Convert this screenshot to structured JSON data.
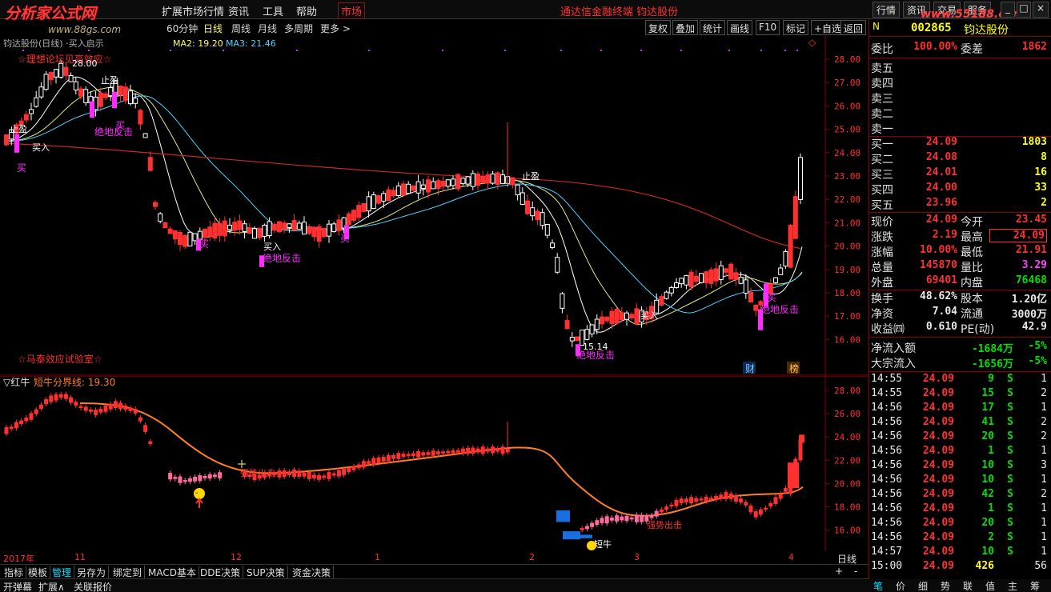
{
  "menubar": {
    "watermark": "分析家公式网",
    "watermark2": "www.88gs.com",
    "items": [
      "扩展市场行情",
      "资讯",
      "工具",
      "帮助"
    ],
    "market_tab": "市场",
    "center_title": "通达信金融终端  钧达股份",
    "right_buttons": [
      "行情",
      "资讯",
      "交易",
      "服务"
    ],
    "wm_site": "www.55188.com"
  },
  "periodbar": {
    "periods": [
      "60分钟",
      "日线",
      "周线",
      "月线",
      "多周期",
      "更多 >"
    ],
    "selected": "日线",
    "ma_text": {
      "ma2": "MA2: 19.20",
      "ma3": "MA3: 21.46"
    },
    "tools": [
      "复权",
      "叠加",
      "统计",
      "画线",
      "F10",
      "标记",
      "+自选",
      "返回"
    ]
  },
  "mainchart": {
    "header_text": "钧达股份(日线) ·买入启示",
    "ytick_labels": [
      "28.00",
      "27.00",
      "26.00",
      "25.00",
      "24.00",
      "23.00",
      "22.00",
      "21.00",
      "20.00",
      "19.00",
      "18.00",
      "17.00",
      "16.00"
    ],
    "annotations": {
      "top_left": "☆理想论坛见高效应☆",
      "bottom_left": "☆马泰效应试验室☆",
      "high_label": "28.00",
      "low_label": "15.14",
      "zhiying1": "止盈",
      "zhiying2": "止盈",
      "zhiying3": "止盈",
      "mairu1": "买入",
      "mairu2": "买入",
      "mairu3": "买入",
      "mai_a": "买",
      "mai_b": "买",
      "mai_c": "买",
      "mai_d": "买",
      "mai_e": "买",
      "fanji1": "绝地反击",
      "fanji2": "绝地反击",
      "fanji3": "绝地反击",
      "fanji4": "绝地反击",
      "cai": "财",
      "bang": "榜"
    }
  },
  "subchart": {
    "title": "▽红牛",
    "line_label": "短牛分界线: 19.30",
    "ytick_labels": [
      "28.00",
      "26.00",
      "24.00",
      "22.00",
      "20.00",
      "18.00",
      "16.00"
    ],
    "annotations": {
      "chuji1": "强势出击",
      "chuji2": "强势出击",
      "duanniu": "短牛"
    }
  },
  "timeaxis": {
    "labels": [
      "2017年",
      "11",
      "12",
      "1",
      "2",
      "3",
      "4"
    ],
    "period": "日线"
  },
  "tabs": [
    "指标",
    "模板",
    "管理",
    "另存为",
    "绑定到",
    "MACD基本",
    "DDE决策",
    "SUP决策",
    "资金决策"
  ],
  "tabs_selected": "管理",
  "status": [
    "开弹幕",
    "扩展∧",
    "关联报价"
  ],
  "rpanel": {
    "code": "002865",
    "name": "钧达股份",
    "weibi": {
      "label": "委比",
      "value": "100.00%",
      "label2": "委差",
      "value2": "1862"
    },
    "sell": [
      {
        "label": "卖五",
        "price": "",
        "vol": ""
      },
      {
        "label": "卖四",
        "price": "",
        "vol": ""
      },
      {
        "label": "卖三",
        "price": "",
        "vol": ""
      },
      {
        "label": "卖二",
        "price": "",
        "vol": ""
      },
      {
        "label": "卖一",
        "price": "",
        "vol": ""
      }
    ],
    "buy": [
      {
        "label": "买一",
        "price": "24.09",
        "vol": "1803"
      },
      {
        "label": "买二",
        "price": "24.08",
        "vol": "8"
      },
      {
        "label": "买三",
        "price": "24.01",
        "vol": "16"
      },
      {
        "label": "买四",
        "price": "24.00",
        "vol": "33"
      },
      {
        "label": "买五",
        "price": "23.96",
        "vol": "2"
      }
    ],
    "stats": [
      {
        "l1": "现价",
        "v1": "24.09",
        "c1": "red",
        "l2": "今开",
        "v2": "23.45",
        "c2": "red"
      },
      {
        "l1": "涨跌",
        "v1": "2.19",
        "c1": "red",
        "l2": "最高",
        "v2": "24.09",
        "c2": "red"
      },
      {
        "l1": "涨幅",
        "v1": "10.00%",
        "c1": "red",
        "l2": "最低",
        "v2": "21.91",
        "c2": "red"
      },
      {
        "l1": "总量",
        "v1": "145870",
        "c1": "red",
        "l2": "量比",
        "v2": "3.29",
        "c2": "mag"
      },
      {
        "l1": "外盘",
        "v1": "69401",
        "c1": "red",
        "l2": "内盘",
        "v2": "76468",
        "c2": "green"
      }
    ],
    "stats2": [
      {
        "l1": "换手",
        "v1": "48.62%",
        "c1": "white",
        "l2": "股本",
        "v2": "1.20亿",
        "c2": "white"
      },
      {
        "l1": "净资",
        "v1": "7.04",
        "c1": "white",
        "l2": "流通",
        "v2": "3000万",
        "c2": "white"
      },
      {
        "l1": "收益㈣",
        "v1": "0.610",
        "c1": "white",
        "l2": "PE(动)",
        "v2": "42.9",
        "c2": "white"
      }
    ],
    "flow": [
      {
        "label": "净流入额",
        "value": "-1684万",
        "pct": "-5%"
      },
      {
        "label": "大宗流入",
        "value": "-1656万",
        "pct": "-5%"
      }
    ],
    "ticks": [
      {
        "t": "14:55",
        "p": "24.09",
        "v": "9",
        "s": "S",
        "n": "1"
      },
      {
        "t": "14:55",
        "p": "24.09",
        "v": "15",
        "s": "S",
        "n": "2"
      },
      {
        "t": "14:56",
        "p": "24.09",
        "v": "17",
        "s": "S",
        "n": "1"
      },
      {
        "t": "14:56",
        "p": "24.09",
        "v": "41",
        "s": "S",
        "n": "2"
      },
      {
        "t": "14:56",
        "p": "24.09",
        "v": "20",
        "s": "S",
        "n": "2"
      },
      {
        "t": "14:56",
        "p": "24.09",
        "v": "1",
        "s": "S",
        "n": "1"
      },
      {
        "t": "14:56",
        "p": "24.09",
        "v": "10",
        "s": "S",
        "n": "3"
      },
      {
        "t": "14:56",
        "p": "24.09",
        "v": "10",
        "s": "S",
        "n": "1"
      },
      {
        "t": "14:56",
        "p": "24.09",
        "v": "42",
        "s": "S",
        "n": "2"
      },
      {
        "t": "14:56",
        "p": "24.09",
        "v": "1",
        "s": "S",
        "n": "1"
      },
      {
        "t": "14:56",
        "p": "24.09",
        "v": "20",
        "s": "S",
        "n": "1"
      },
      {
        "t": "14:56",
        "p": "24.09",
        "v": "2",
        "s": "S",
        "n": "1"
      },
      {
        "t": "14:57",
        "p": "24.09",
        "v": "10",
        "s": "S",
        "n": "1"
      },
      {
        "t": "15:00",
        "p": "24.09",
        "v": "426",
        "s": "",
        "n": "56"
      }
    ],
    "bottom_tabs": [
      "笔",
      "价",
      "细",
      "势",
      "联",
      "值",
      "主",
      "筹"
    ]
  },
  "colors": {
    "up": "#ff3030",
    "down": "#ffffff",
    "ma_white": "#ffffff",
    "ma_yellow": "#e6e67a",
    "ma_cyan": "#4dd2ff",
    "ma_red": "#c62828",
    "orange": "#ff7f27",
    "pink": "#ff6b9e",
    "blue": "#1a6fe0",
    "magenta": "#ff2bff"
  }
}
